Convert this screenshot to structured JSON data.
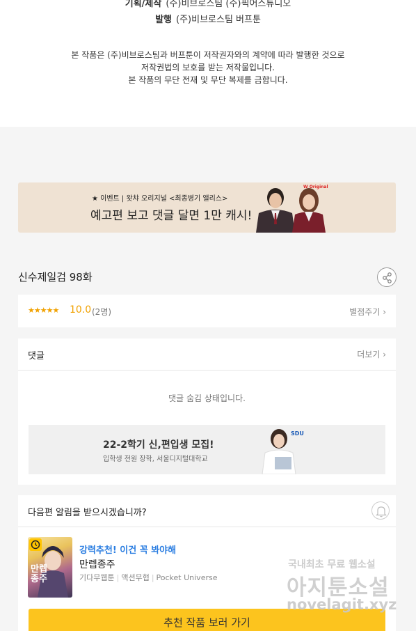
{
  "credits": {
    "planning_label": "기획/제작",
    "planning_value": "(주)비브로스팀 (주)픽어스튜디오",
    "publisher_label": "발행",
    "publisher_value": "(주)비브로스팀 버프툰",
    "notice_1": "본 작품은 (주)비브로스팀과 버프툰이 저작권자와의 계약에 따라 발행한 것으로",
    "notice_2": "저작권법의 보호를 받는 저작물입니다.",
    "notice_3": "본 작품의 무단 전재 및 무단 복제를 금합니다."
  },
  "banner": {
    "small_text": "★ 이벤트 | 왓챠 오리지널 <최종병기 앨리스>",
    "big_text": "예고편 보고 댓글 달면 1만 캐시!",
    "logo": "W Original"
  },
  "episode": {
    "title": "신수제일검 98화",
    "share_icon": "share-icon"
  },
  "rating": {
    "stars": "★★★★★",
    "score": "10.0",
    "count": "(2명)",
    "rate_link": "별점주기 ›"
  },
  "comments": {
    "title": "댓글",
    "more": "더보기 ›",
    "hidden_msg": "댓글 숨김 상태입니다.",
    "ad": {
      "title": "22-2학기 신,편입생 모집!",
      "subtitle": "입학생 전원 장학, 서울디지털대학교",
      "logo": "SDU"
    }
  },
  "notify": {
    "question": "다음편 알림을 받으시겠습니까?",
    "bell_icon": "bell-icon",
    "recommend": {
      "tag": "강력추천! 이건 꼭 봐야해",
      "title": "만렙종주",
      "genre1": "기다무웹툰",
      "genre2": "액션무협",
      "genre3": "Pocket Universe",
      "thumb_text": "만렙종주"
    },
    "button": "추천 작품 보러 가기"
  },
  "watermark": {
    "line1": "국내최초 무료 웹소설",
    "line2": "아지툰소설",
    "line3": "novelagit.xyz"
  },
  "colors": {
    "accent_yellow": "#fcc41e",
    "star_orange": "#f1a100",
    "link_blue": "#2a7de1",
    "banner_bg": "#efe2d3"
  }
}
